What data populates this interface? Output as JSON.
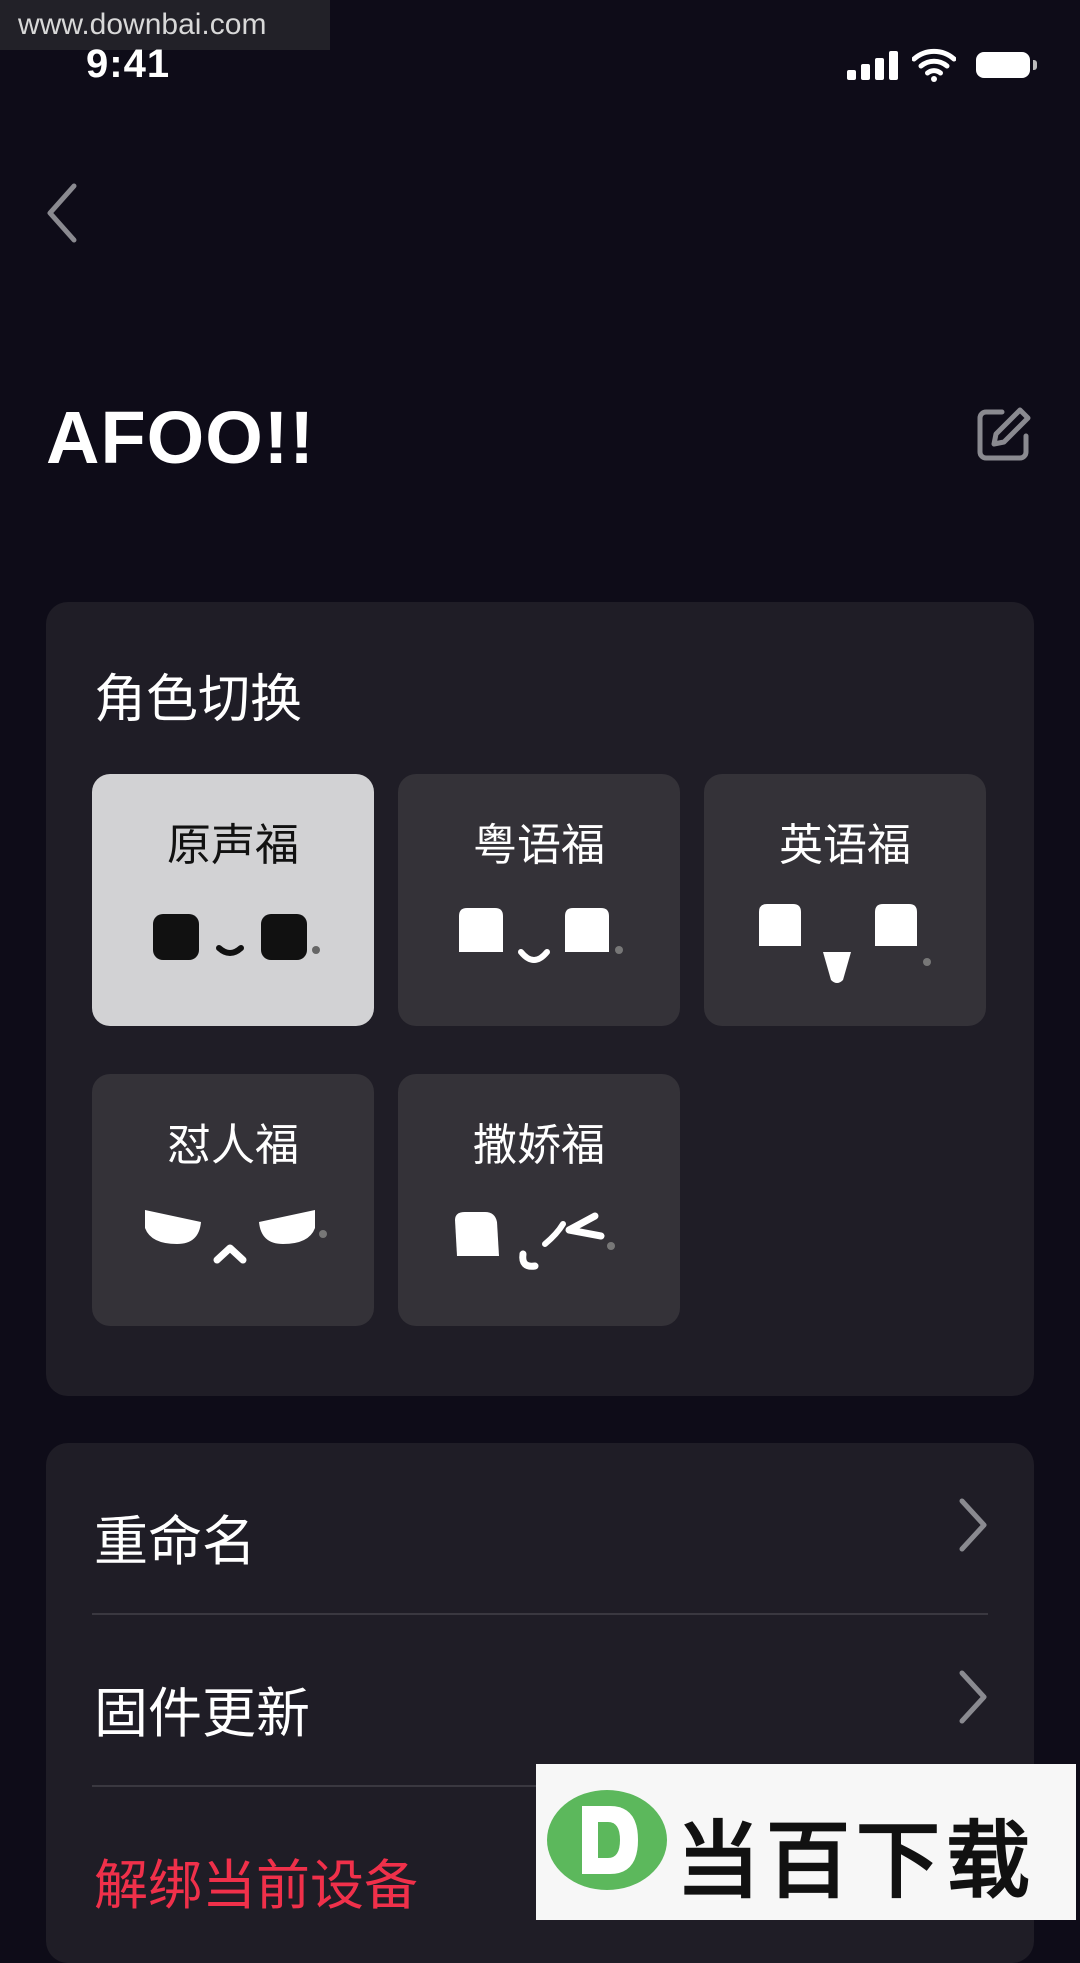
{
  "watermark": {
    "url": "www.downbai.com",
    "logo_text": "当百下载"
  },
  "status_bar": {
    "time": "9:41"
  },
  "header": {
    "device_name": "AFOO!!"
  },
  "role_switch": {
    "title": "角色切换",
    "selected": "原声福",
    "roles": [
      {
        "label": "原声福",
        "face": "neutral"
      },
      {
        "label": "粤语福",
        "face": "smile"
      },
      {
        "label": "英语福",
        "face": "tongue"
      },
      {
        "label": "怼人福",
        "face": "angry"
      },
      {
        "label": "撒娇福",
        "face": "wink"
      }
    ]
  },
  "menu": {
    "rename": "重命名",
    "firmware_update": "固件更新",
    "unbind_device": "解绑当前设备"
  },
  "colors": {
    "background": "#0e0c18",
    "card": "#1f1d26",
    "tile": "#343238",
    "tile_selected": "#d2d2d4",
    "danger": "#f0304a"
  }
}
